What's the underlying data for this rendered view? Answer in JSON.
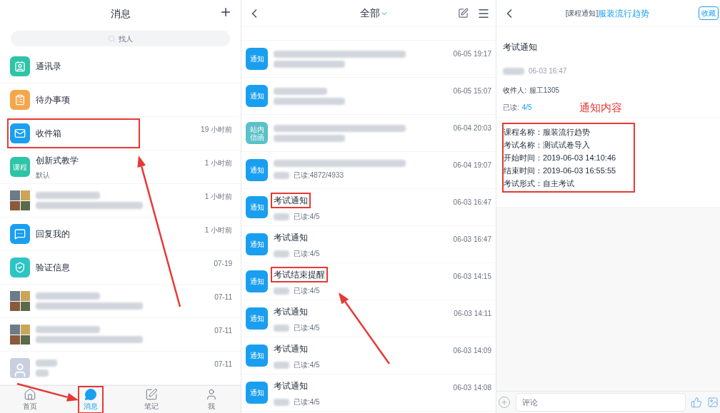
{
  "messages_screen": {
    "title": "消息",
    "search": {
      "placeholder": "找人"
    },
    "items": [
      {
        "kind": "contacts",
        "title": "通讯录",
        "highlighted": false
      },
      {
        "kind": "todo",
        "title": "待办事项",
        "highlighted": false
      },
      {
        "kind": "inbox",
        "title": "收件箱",
        "time": "19 小时前",
        "highlighted": true
      },
      {
        "kind": "course",
        "badge": "课程",
        "title": "创新式教学",
        "subtitle": "默认",
        "time": "1 小时前",
        "highlighted": false
      },
      {
        "kind": "group",
        "time": "1 小时前",
        "highlighted": false
      },
      {
        "kind": "reply",
        "title": "回复我的",
        "time": "1 小时前",
        "highlighted": false
      },
      {
        "kind": "verify",
        "title": "验证信息",
        "time": "07-19",
        "highlighted": false
      },
      {
        "kind": "group",
        "time": "07-11",
        "highlighted": false
      },
      {
        "kind": "group",
        "time": "07-11",
        "highlighted": false
      },
      {
        "kind": "person",
        "time": "07-11",
        "highlighted": false
      }
    ],
    "nav": [
      {
        "kind": "home",
        "label": "首页",
        "selected": false,
        "highlighted": false
      },
      {
        "kind": "messages",
        "label": "消息",
        "selected": true,
        "highlighted": true
      },
      {
        "kind": "notes",
        "label": "笔记",
        "selected": false,
        "highlighted": false
      },
      {
        "kind": "me",
        "label": "我",
        "selected": false,
        "highlighted": false
      }
    ]
  },
  "inbox_screen": {
    "filter": "全部",
    "items": [
      {
        "kind": "notice",
        "badge": "通知",
        "time": "06-05 19:17",
        "highlighted": false
      },
      {
        "kind": "notice",
        "badge": "通知",
        "time": "06-05 15:07",
        "highlighted": false
      },
      {
        "kind": "letter",
        "badge": "站内信函",
        "time": "06-04 20:03",
        "highlighted": false
      },
      {
        "kind": "notice",
        "badge": "通知",
        "time": "06-04 19:07",
        "read": "已读:4872/4933",
        "highlighted": false
      },
      {
        "kind": "notice",
        "badge": "通知",
        "title": "考试通知",
        "time": "06-03 16:47",
        "read": "已读:4/5",
        "highlighted": true
      },
      {
        "kind": "notice",
        "badge": "通知",
        "title": "考试通知",
        "time": "06-03 16:47",
        "read": "已读:4/5",
        "highlighted": false
      },
      {
        "kind": "notice",
        "badge": "通知",
        "title": "考试结束提醒",
        "time": "06-03 14:15",
        "read": "已读:4/5",
        "highlighted": true
      },
      {
        "kind": "notice",
        "badge": "通知",
        "title": "考试通知",
        "time": "06-03 14:11",
        "read": "已读:4/5",
        "highlighted": false
      },
      {
        "kind": "notice",
        "badge": "通知",
        "title": "考试通知",
        "time": "06-03 14:09",
        "read": "已读:4/5",
        "highlighted": false
      },
      {
        "kind": "notice",
        "badge": "通知",
        "title": "考试通知",
        "time": "06-03 14:08",
        "read": "已读:4/5",
        "highlighted": false
      }
    ]
  },
  "detail_screen": {
    "title_prefix": "[课程通知]",
    "title": "服装流行趋势",
    "favorite_button": "收藏",
    "heading": "考试通知",
    "time": "06-03 16:47",
    "recipient_label": "收件人:",
    "recipient": "服工1305",
    "read_label": "已读:",
    "read_count": "4/5",
    "annotation": "通知内容",
    "content_lines": [
      "课程名称：服装流行趋势",
      "考试名称：测试试卷导入",
      "开始时间：2019-06-03 14:10:46",
      "结束时间：2019-06-03 16:55:55",
      "考试形式：自主考试"
    ],
    "comment": {
      "placeholder": "评论"
    }
  }
}
